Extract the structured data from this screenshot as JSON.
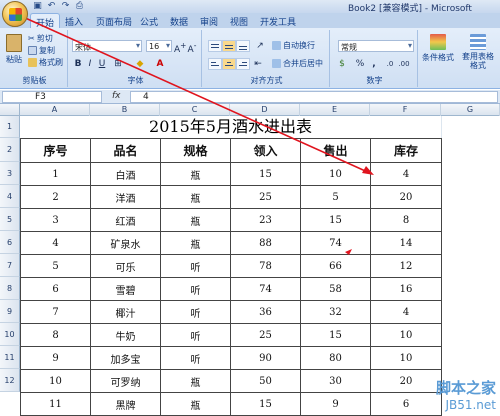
{
  "titlebar": {
    "title": "Book2 [兼容模式] - Microsoft",
    "qat": [
      "save-icon",
      "undo-icon",
      "redo-icon",
      "print-icon"
    ]
  },
  "tabs": [
    "开始",
    "插入",
    "页面布局",
    "公式",
    "数据",
    "审阅",
    "视图",
    "开发工具"
  ],
  "ribbon": {
    "clipboard": {
      "paste": "粘贴",
      "cut": "剪切",
      "copy": "复制",
      "painter": "格式刷",
      "label": "剪贴板"
    },
    "font": {
      "name": "宋体",
      "size": "16",
      "label": "字体"
    },
    "align": {
      "wrap": "自动换行",
      "merge": "合并后居中",
      "label": "对齐方式"
    },
    "number": {
      "format": "常规",
      "label": "数字"
    },
    "styles": {
      "cond": "条件格式",
      "table": "套用表格格式"
    }
  },
  "formula_bar": {
    "cell": "F3",
    "fx": "fx",
    "value": "4"
  },
  "columns": [
    "A",
    "B",
    "C",
    "D",
    "E",
    "F",
    "G"
  ],
  "rows": [
    "1",
    "2",
    "3",
    "4",
    "5",
    "6",
    "7",
    "8",
    "9",
    "10",
    "11",
    "12"
  ],
  "sheet": {
    "title": "2015年5月酒水进出表",
    "headers": [
      "序号",
      "品名",
      "规格",
      "领入",
      "售出",
      "库存"
    ],
    "records": [
      [
        "1",
        "白酒",
        "瓶",
        "15",
        "10",
        "4"
      ],
      [
        "2",
        "洋酒",
        "瓶",
        "25",
        "5",
        "20"
      ],
      [
        "3",
        "红酒",
        "瓶",
        "23",
        "15",
        "8"
      ],
      [
        "4",
        "矿泉水",
        "瓶",
        "88",
        "74",
        "14"
      ],
      [
        "5",
        "可乐",
        "听",
        "78",
        "66",
        "12"
      ],
      [
        "6",
        "雪碧",
        "听",
        "74",
        "58",
        "16"
      ],
      [
        "7",
        "椰汁",
        "听",
        "36",
        "32",
        "4"
      ],
      [
        "8",
        "牛奶",
        "听",
        "25",
        "15",
        "10"
      ],
      [
        "9",
        "加多宝",
        "听",
        "90",
        "80",
        "10"
      ],
      [
        "10",
        "可罗纳",
        "瓶",
        "50",
        "30",
        "20"
      ],
      [
        "11",
        "黑牌",
        "瓶",
        "15",
        "9",
        "6"
      ]
    ]
  },
  "watermark": {
    "main": "脚本之家",
    "sub": "JB51.net"
  },
  "colors": {
    "annotation": "#e0141e",
    "ribbon": "#dbe7f6",
    "watermark": "#5a9bd5"
  }
}
